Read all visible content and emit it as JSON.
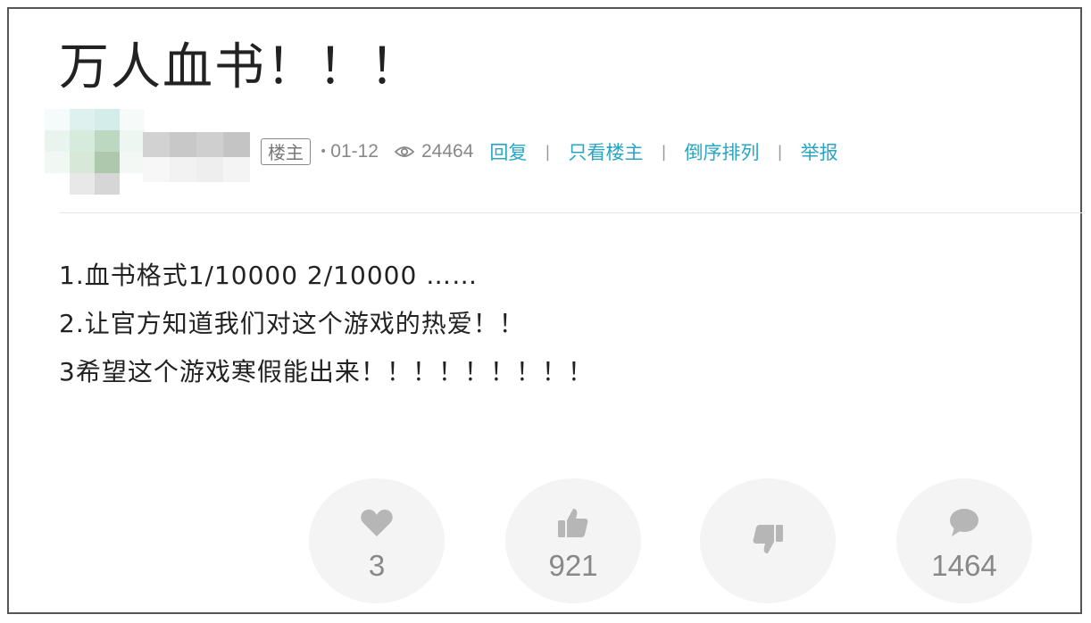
{
  "post": {
    "title": "万人血书！！！",
    "author_badge": "楼主",
    "date": "01-12",
    "views": "24464",
    "actions": [
      "回复",
      "只看楼主",
      "倒序排列",
      "举报"
    ],
    "body_lines": [
      "1.血书格式1/10000 2/10000 ……",
      "2.让官方知道我们对这个游戏的热爱！！",
      "3希望这个游戏寒假能出来！！！！！！！！！"
    ]
  },
  "stats": {
    "favorite": {
      "icon": "heart-icon",
      "count": "3"
    },
    "like": {
      "icon": "thumbs-up-icon",
      "count": "921"
    },
    "dislike": {
      "icon": "thumbs-down-icon",
      "count": ""
    },
    "comments": {
      "icon": "speech-bubble-icon",
      "count": "1464"
    }
  },
  "colors": {
    "link": "#29a6c4",
    "muted": "#888888",
    "text": "#222222",
    "stat_bg": "#f4f4f4"
  }
}
